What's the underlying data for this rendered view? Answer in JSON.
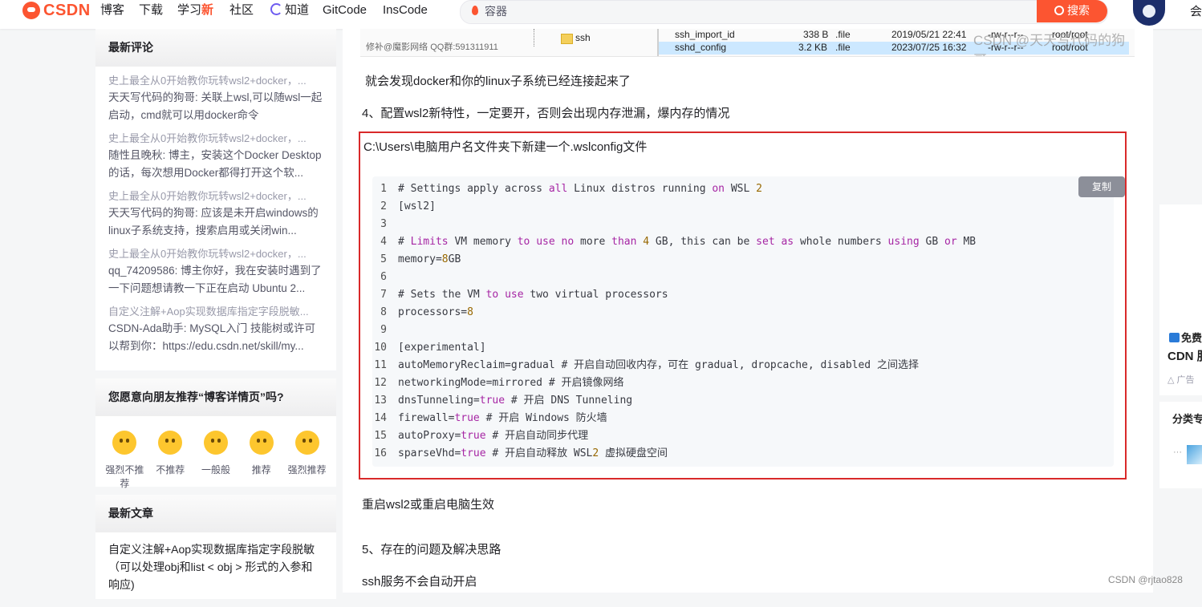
{
  "nav": {
    "logo": "CSDN",
    "items": [
      "博客",
      "下载",
      "学习",
      "社区",
      "知道",
      "GitCode",
      "InsCode"
    ],
    "new_badge": "新",
    "search_placeholder": "容器",
    "search_button": "搜索",
    "right_text": "会"
  },
  "sidebar": {
    "comments_title": "最新评论",
    "comments": [
      {
        "title": "史上最全从0开始教你玩转wsl2+docker，...",
        "body": "天天写代码的狗哥: 关联上wsl,可以随wsl一起启动，cmd就可以用docker命令"
      },
      {
        "title": "史上最全从0开始教你玩转wsl2+docker，...",
        "body": "随性且晚秋: 博主，安装这个Docker Desktop的话，每次想用Docker都得打开这个软..."
      },
      {
        "title": "史上最全从0开始教你玩转wsl2+docker，...",
        "body": "天天写代码的狗哥: 应该是未开启windows的linux子系统支持，搜索启用或关闭win..."
      },
      {
        "title": "史上最全从0开始教你玩转wsl2+docker，...",
        "body": "qq_74209586: 博主你好，我在安装时遇到了一下问题想请教一下正在启动 Ubuntu 2..."
      },
      {
        "title": "自定义注解+Aop实现数据库指定字段脱敏...",
        "body": "CSDN-Ada助手: MySQL入门 技能树或许可以帮到你：https://edu.csdn.net/skill/my..."
      }
    ],
    "recommend_title": "您愿意向朋友推荐“博客详情页”吗?",
    "recommend_options": [
      "强烈不推荐",
      "不推荐",
      "一般般",
      "推荐",
      "强烈推荐"
    ],
    "articles_title": "最新文章",
    "articles": [
      "自定义注解+Aop实现数据库指定字段脱敏（可以处理obj和list < obj > 形式的入参和响应)"
    ]
  },
  "main": {
    "screenshot": {
      "folder_label": "ssh",
      "footer_text": "修补@魔影网络 QQ群:591311911",
      "watermark": "CSDN @天天写代码的狗哥",
      "files": [
        {
          "name": "ssh_import_id",
          "size": "338 B",
          "type": ".file",
          "date": "2019/05/21 22:41",
          "perm": "-rw-r--r--",
          "owner": "root/root"
        },
        {
          "name": "sshd_config",
          "size": "3.2 KB",
          "type": ".file",
          "date": "2023/07/25 16:32",
          "perm": "-rw-r--r--",
          "owner": "root/root"
        }
      ]
    },
    "text_docker_connected": "就会发现docker和你的linux子系统已经连接起来了",
    "heading_4": "4、配置wsl2新特性，一定要开，否则会出现内存泄漏，爆内存的情况",
    "box_title": "C:\\Users\\电脑用户名文件夹下新建一个.wslconfig文件",
    "copy_button": "复制",
    "code_lines": [
      "# Settings apply across all Linux distros running on WSL 2",
      "[wsl2]",
      "",
      "# Limits VM memory to use no more than 4 GB, this can be set as whole numbers using GB or MB",
      "memory=8GB",
      "",
      "# Sets the VM to use two virtual processors",
      "processors=8",
      "",
      "[experimental]",
      "autoMemoryReclaim=gradual # 开启自动回收内存，可在 gradual, dropcache, disabled 之间选择",
      "networkingMode=mirrored # 开启镜像网络",
      "dnsTunneling=true # 开启 DNS Tunneling",
      "firewall=true # 开启 Windows 防火墙",
      "autoProxy=true # 开启自动同步代理",
      "sparseVhd=true # 开启自动释放 WSL2 虚拟硬盘空间"
    ],
    "text_restart": "重启wsl2或重启电脑生效",
    "heading_5": "5、存在的问题及解决思路",
    "text_ssh": "ssh服务不会自动开启"
  },
  "right": {
    "ad_free": "免费",
    "ad_cdn": "CDN 服",
    "ad_label": "广告",
    "category_title": "分类专",
    "category_dots": "···"
  },
  "footer_watermark": "CSDN @rjtao828"
}
